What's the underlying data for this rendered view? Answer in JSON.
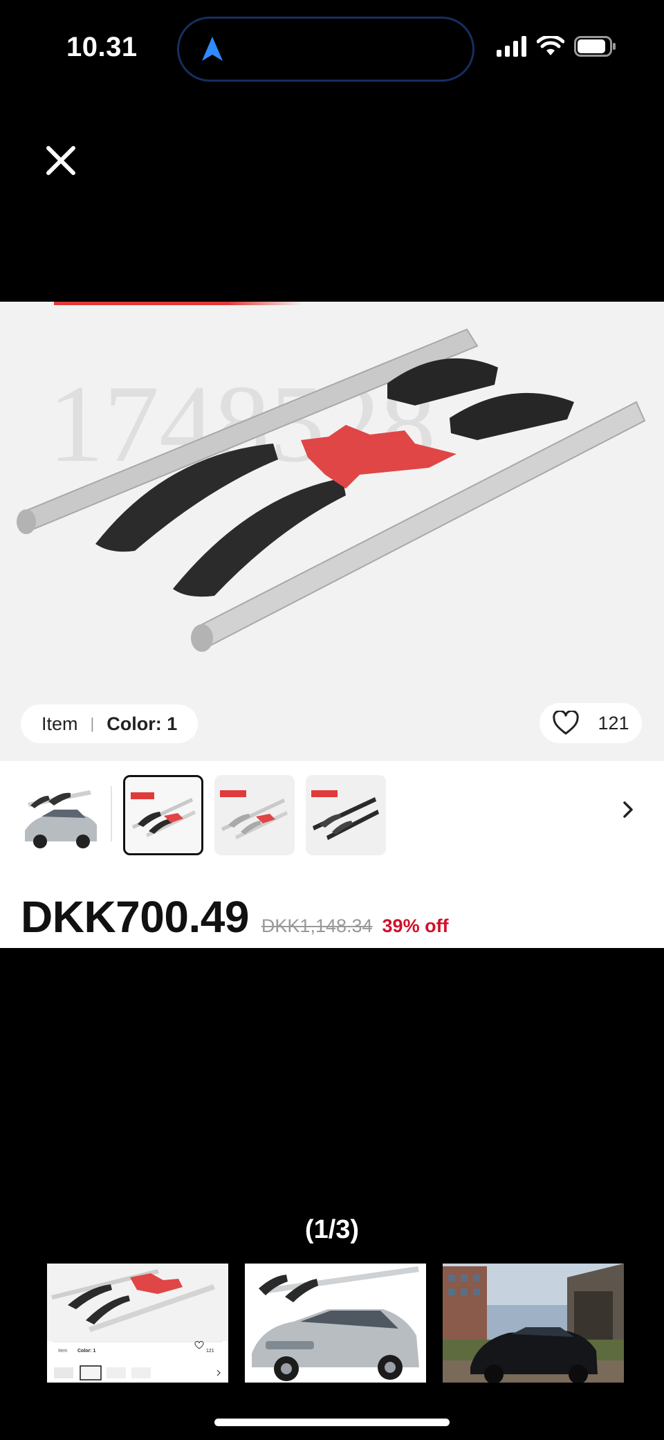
{
  "status_bar": {
    "time": "10.31",
    "nav_icon": "navigation-arrow-icon",
    "signal_icon": "cellular-signal-icon",
    "wifi_icon": "wifi-icon",
    "battery_icon": "battery-icon"
  },
  "close_icon": "close-icon",
  "product": {
    "watermark": "1748528",
    "variant": {
      "item_label": "Item",
      "separator": "|",
      "color_label": "Color: 1"
    },
    "likes": {
      "icon": "heart-icon",
      "count": "121"
    },
    "thumbnails": [
      {
        "name": "car-photo-thumbnail",
        "selected": false
      },
      {
        "name": "silver-black-rails-thumbnail",
        "selected": true
      },
      {
        "name": "silver-rails-thumbnail",
        "selected": false
      },
      {
        "name": "black-rails-thumbnail",
        "selected": false
      }
    ],
    "thumbnails_next_icon": "chevron-right-icon",
    "price": "DKK700.49",
    "original_price": "DKK1,148.34",
    "discount": "39% off"
  },
  "gallery": {
    "counter": "(1/3)",
    "mini_variant": {
      "item_label": "Item",
      "color_label": "Color: 1",
      "likes": "121"
    }
  },
  "colors": {
    "accent_red": "#d0102a",
    "background": "#000000",
    "card": "#ffffff"
  }
}
